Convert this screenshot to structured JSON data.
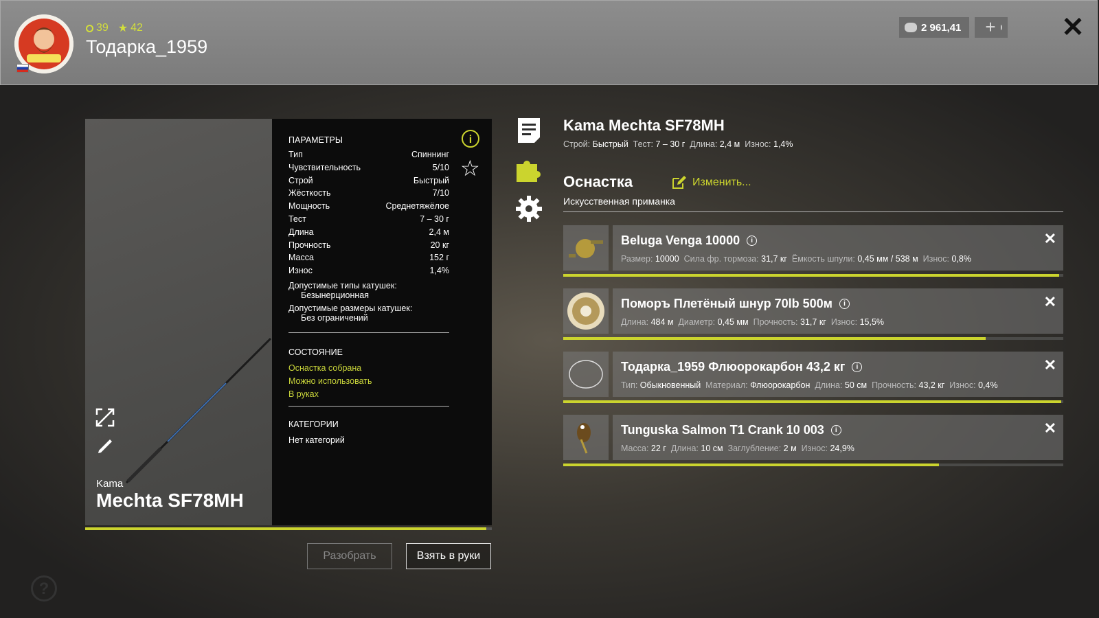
{
  "header": {
    "level": "39",
    "stars": "42",
    "username": "Тодарка_1959",
    "silver": "2 961,41",
    "gold": "0",
    "plus": "+",
    "close": "✕"
  },
  "rod": {
    "brand": "Kama",
    "model": "Mechta SF78MH",
    "condition_fraction": 0.986
  },
  "params": {
    "title": "ПАРАМЕТРЫ",
    "rows": [
      {
        "label": "Тип",
        "value": "Спиннинг"
      },
      {
        "label": "Чувствительность",
        "value": "5/10"
      },
      {
        "label": "Строй",
        "value": "Быстрый"
      },
      {
        "label": "Жёсткость",
        "value": "7/10"
      },
      {
        "label": "Мощность",
        "value": "Среднетяжёлое"
      },
      {
        "label": "Тест",
        "value": "7 – 30 г"
      },
      {
        "label": "Длина",
        "value": "2,4 м"
      },
      {
        "label": "Прочность",
        "value": "20 кг"
      },
      {
        "label": "Масса",
        "value": "152 г"
      },
      {
        "label": "Износ",
        "value": "1,4%"
      }
    ],
    "reel_types_label": "Допустимые типы катушек:",
    "reel_types_value": "Безынерционная",
    "reel_sizes_label": "Допустимые размеры катушек:",
    "reel_sizes_value": "Без ограничений",
    "state_title": "СОСТОЯНИЕ",
    "state_items": [
      "Оснастка собрана",
      "Можно использовать",
      "В руках"
    ],
    "categories_title": "КАТЕГОРИИ",
    "categories_value": "Нет категорий",
    "info": "i",
    "star": "☆"
  },
  "buttons": {
    "disassemble": "Разобрать",
    "take": "Взять в руки",
    "help": "?"
  },
  "detail": {
    "title": "Kama Mechta SF78MH",
    "action_label": "Строй:",
    "action_value": "Быстрый",
    "test_label": "Тест:",
    "test_value": "7 – 30 г",
    "length_label": "Длина:",
    "length_value": "2,4 м",
    "wear_label": "Износ:",
    "wear_value": "1,4%"
  },
  "tackle": {
    "title": "Оснастка",
    "edit": "Изменить...",
    "subtitle": "Искусственная приманка",
    "items": [
      {
        "name": "Beluga Venga 10000",
        "stats": [
          {
            "label": "Размер:",
            "value": "10000"
          },
          {
            "label": "Сила фр. тормоза:",
            "value": "31,7 кг"
          },
          {
            "label": "Ёмкость шпули:",
            "value": "0,45 мм / 538 м"
          },
          {
            "label": "Износ:",
            "value": "0,8%",
            "green": true
          }
        ],
        "condition": 0.992
      },
      {
        "name": "Поморъ Плетёный шнур 70lb 500м",
        "stats": [
          {
            "label": "Длина:",
            "value": "484 м"
          },
          {
            "label": "Диаметр:",
            "value": "0,45 мм"
          },
          {
            "label": "Прочность:",
            "value": "31,7 кг"
          },
          {
            "label": "Износ:",
            "value": "15,5%",
            "green": true
          }
        ],
        "condition": 0.845
      },
      {
        "name": "Тодарка_1959 Флюорокарбон 43,2 кг",
        "stats": [
          {
            "label": "Тип:",
            "value": "Обыкновенный"
          },
          {
            "label": "Материал:",
            "value": "Флюорокарбон"
          },
          {
            "label": "Длина:",
            "value": "50 см"
          },
          {
            "label": "Прочность:",
            "value": "43,2 кг"
          },
          {
            "label": "Износ:",
            "value": "0,4%",
            "green": true
          }
        ],
        "condition": 0.996
      },
      {
        "name": "Tunguska Salmon T1 Crank 10 003",
        "stats": [
          {
            "label": "Масса:",
            "value": "22 г"
          },
          {
            "label": "Длина:",
            "value": "10 см"
          },
          {
            "label": "Заглубление:",
            "value": "2 м"
          },
          {
            "label": "Износ:",
            "value": "24,9%",
            "green": true
          }
        ],
        "condition": 0.751
      }
    ]
  },
  "colors": {
    "accent": "#cbd42e"
  }
}
